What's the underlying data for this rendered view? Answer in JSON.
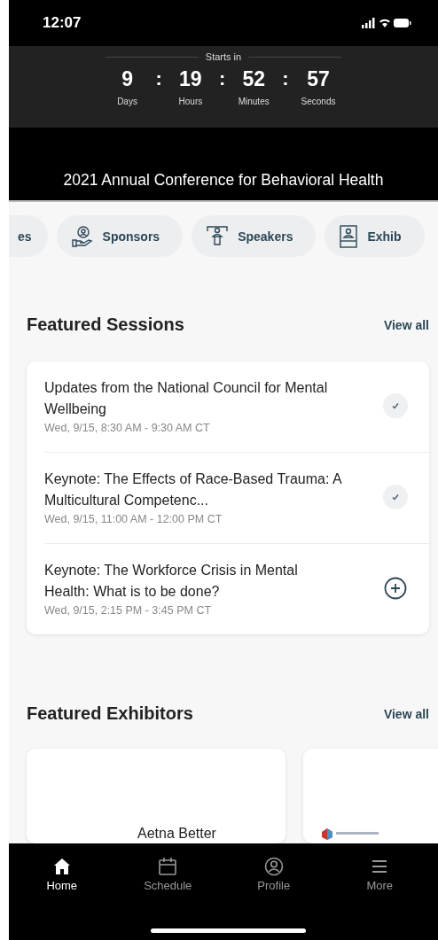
{
  "status_bar": {
    "time": "12:07"
  },
  "countdown": {
    "label": "Starts in",
    "units": [
      {
        "value": "9",
        "label": "Days"
      },
      {
        "value": "19",
        "label": "Hours"
      },
      {
        "value": "52",
        "label": "Minutes"
      },
      {
        "value": "57",
        "label": "Seconds"
      }
    ],
    "separator": ":"
  },
  "event_title": "2021 Annual Conference for Behavioral Health",
  "shortcuts": [
    {
      "label": "es",
      "kind": "none"
    },
    {
      "label": "Sponsors",
      "kind": "sponsors"
    },
    {
      "label": "Speakers",
      "kind": "speakers"
    },
    {
      "label": "Exhib",
      "kind": "exhibitors"
    }
  ],
  "featured_sessions": {
    "title": "Featured Sessions",
    "action": "View all",
    "sessions": [
      {
        "title": "Updates from the National Council for Mental Wellbeing",
        "time": "Wed, 9/15, 8:30 AM - 9:30 AM CT",
        "added": true
      },
      {
        "title": "Keynote: The Effects of Race-Based Trauma: A Multicultural Competenc...",
        "time": "Wed, 9/15, 11:00 AM - 12:00 PM CT",
        "added": true
      },
      {
        "title": "Keynote: The Workforce Crisis in Mental Health: What is to be done?",
        "time": "Wed, 9/15, 2:15 PM - 3:45 PM CT",
        "added": false
      }
    ]
  },
  "featured_exhibitors": {
    "title": "Featured Exhibitors",
    "action": "View all",
    "exhibitors": [
      {
        "name": "Aetna Better",
        "kind": "text"
      },
      {
        "kind": "logo"
      }
    ]
  },
  "tab_bar": [
    {
      "label": "Home",
      "kind": "home",
      "selected": true
    },
    {
      "label": "Schedule",
      "kind": "schedule",
      "selected": false
    },
    {
      "label": "Profile",
      "kind": "profile",
      "selected": false
    },
    {
      "label": "More",
      "kind": "more",
      "selected": false
    }
  ]
}
